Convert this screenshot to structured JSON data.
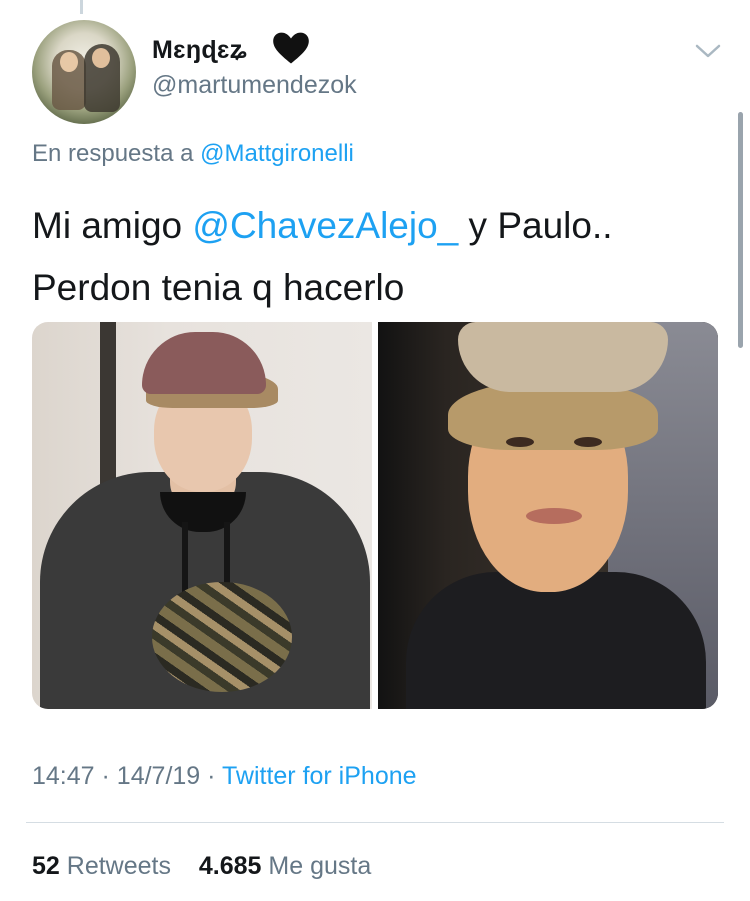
{
  "author": {
    "display_name": "Mɛŋɖɛʑ",
    "handle": "@martumendezok"
  },
  "reply": {
    "prefix": "En respuesta a",
    "mention": "@Mattgironelli"
  },
  "tweet": {
    "text_before": "Mi amigo",
    "mention": "@ChavezAlejo_",
    "text_after": "y Paulo..",
    "line2": "Perdon tenia q hacerlo"
  },
  "meta": {
    "time": "14:47",
    "separator": "·",
    "date": "14/7/19",
    "source": "Twitter for iPhone"
  },
  "stats": {
    "retweets_count": "52",
    "retweets_label": "Retweets",
    "likes_count": "4.685",
    "likes_label": "Me gusta"
  },
  "icons": {
    "heart": "black-heart-icon",
    "menu": "chevron-down-icon"
  },
  "colors": {
    "link": "#1da1f2",
    "muted": "#657786",
    "text": "#14171a"
  }
}
